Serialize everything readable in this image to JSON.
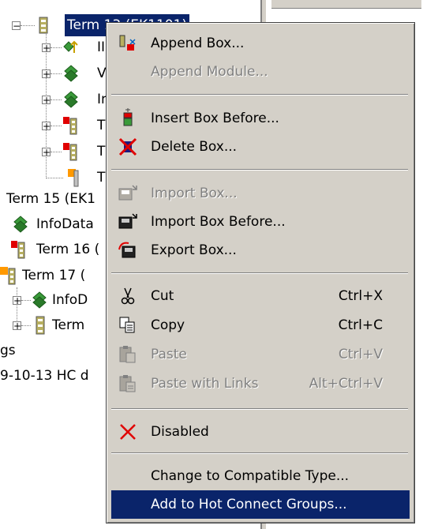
{
  "tree": {
    "selected_label": "Term 13 (EK1101)",
    "children": [
      "II",
      "V",
      "In",
      "T",
      "T",
      "T"
    ],
    "term15": "Term 15 (EK1",
    "infodata": "InfoData",
    "term16": "Term 16 (",
    "term17": "Term 17 (",
    "infod": "InfoD",
    "term": "Term",
    "gs": "gs",
    "hc": "9-10-13 HC d"
  },
  "menu": {
    "append_box": "Append Box...",
    "append_module": "Append Module...",
    "insert_box_before": "Insert Box Before...",
    "delete_box": "Delete Box...",
    "import_box": "Import Box...",
    "import_box_before": "Import Box Before...",
    "export_box": "Export Box...",
    "cut": "Cut",
    "cut_shortcut": "Ctrl+X",
    "copy": "Copy",
    "copy_shortcut": "Ctrl+C",
    "paste": "Paste",
    "paste_shortcut": "Ctrl+V",
    "paste_links": "Paste with Links",
    "paste_links_shortcut": "Alt+Ctrl+V",
    "disabled": "Disabled",
    "change_type": "Change to Compatible Type...",
    "add_hot_connect": "Add to Hot Connect Groups..."
  },
  "colors": {
    "selection": "#0a246a",
    "menu_bg": "#d4d0c8",
    "disabled_text": "#808080"
  }
}
